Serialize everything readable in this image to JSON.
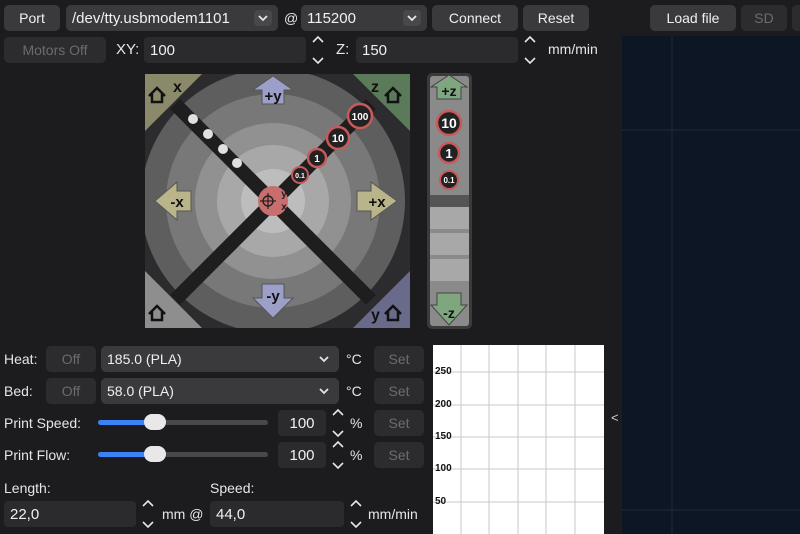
{
  "toolbar": {
    "port_label": "Port",
    "port_value": "/dev/tty.usbmodem1101",
    "at_symbol": "@",
    "baud_value": "115200",
    "connect_label": "Connect",
    "reset_label": "Reset",
    "load_file_label": "Load file",
    "sd_label": "SD"
  },
  "motion": {
    "motors_off_label": "Motors Off",
    "xy_label": "XY:",
    "xy_value": "100",
    "z_label": "Z:",
    "z_value": "150",
    "unit": "mm/min"
  },
  "jog": {
    "home_x": "x",
    "home_z": "z",
    "home_y": "y",
    "plus_y": "+y",
    "minus_y": "-y",
    "plus_x": "+x",
    "minus_x": "-x",
    "center_y": "y",
    "center_x": "x",
    "step_100": "100",
    "step_10": "10",
    "step_1": "1",
    "step_01": "0.1"
  },
  "zjog": {
    "plus_z": "+z",
    "minus_z": "-z",
    "step_10": "10",
    "step_1": "1",
    "step_01": "0.1"
  },
  "controls": {
    "heat_label": "Heat:",
    "heat_off": "Off",
    "heat_value": "185.0 (PLA)",
    "heat_unit": "°C",
    "heat_set": "Set",
    "bed_label": "Bed:",
    "bed_off": "Off",
    "bed_value": "58.0 (PLA)",
    "bed_unit": "°C",
    "bed_set": "Set",
    "speed_label": "Print Speed:",
    "speed_value": "100",
    "speed_percent": 100,
    "speed_unit": "%",
    "speed_set": "Set",
    "flow_label": "Print Flow:",
    "flow_value": "100",
    "flow_percent": 100,
    "flow_unit": "%",
    "flow_set": "Set",
    "length_label": "Length:",
    "length_value": "22,0",
    "length_unit": "mm @",
    "extrude_speed_label": "Speed:",
    "extrude_speed_value": "44,0",
    "extrude_speed_unit": "mm/min"
  },
  "graph": {
    "ticks": [
      "250",
      "200",
      "150",
      "100",
      "50"
    ]
  },
  "panel": {
    "collapse_glyph": "<"
  },
  "colors": {
    "accent": "#3b82f6",
    "background": "#1c1c1e",
    "preview_bg": "#0d1624"
  }
}
